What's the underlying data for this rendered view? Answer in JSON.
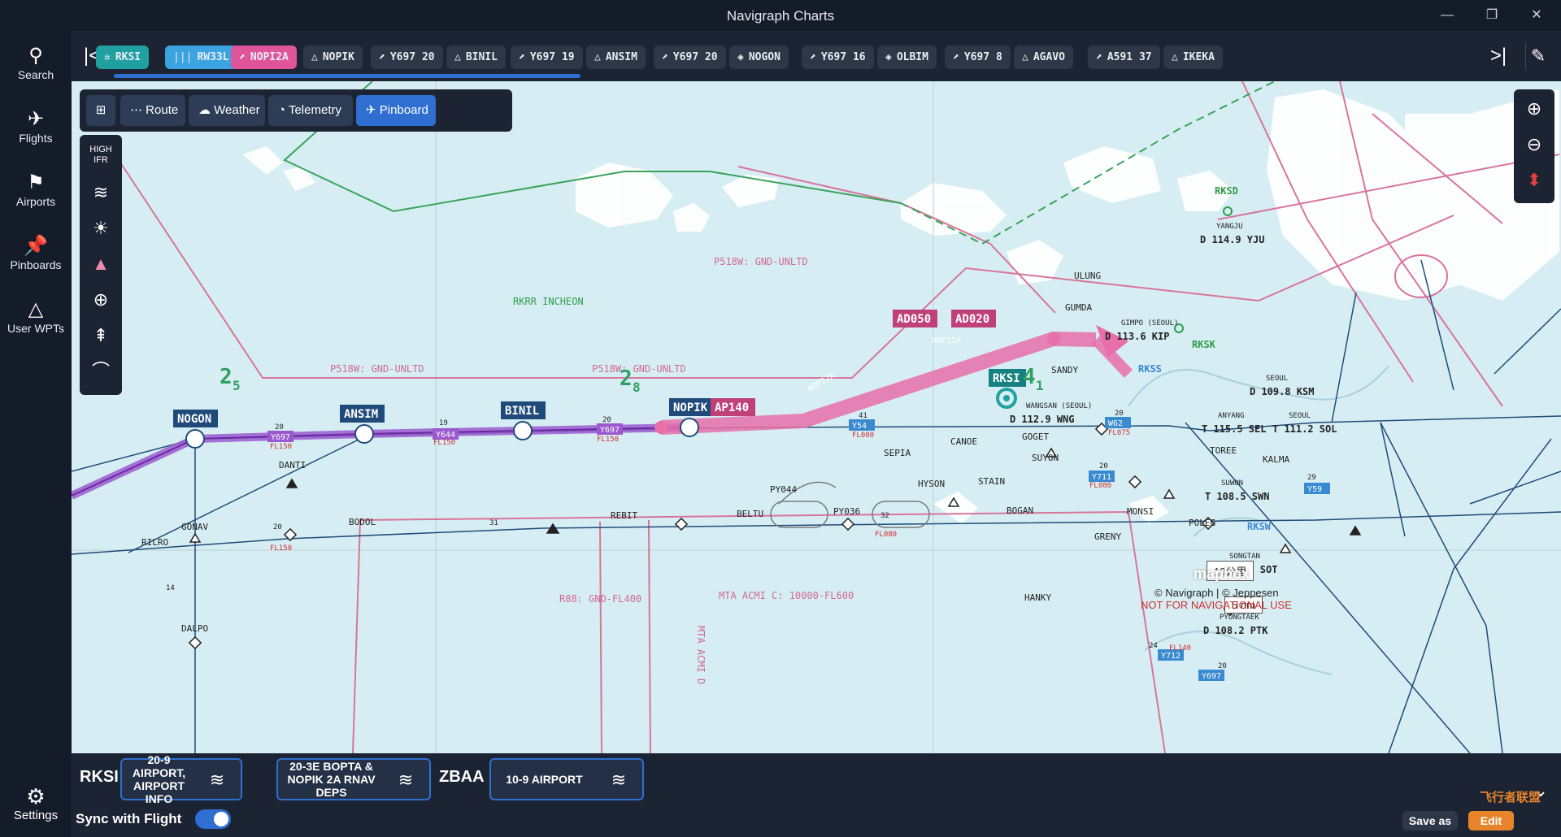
{
  "window": {
    "title": "Navigraph Charts",
    "minimize": "—",
    "maximize": "❐",
    "close": "✕"
  },
  "sidebar": {
    "items": [
      {
        "label": "Search",
        "icon": "search-icon",
        "glyph": "⚲"
      },
      {
        "label": "Flights",
        "icon": "airplane-icon",
        "glyph": "✈"
      },
      {
        "label": "Airports",
        "icon": "windsock-icon",
        "glyph": "⚑"
      },
      {
        "label": "Pinboards",
        "icon": "pin-icon",
        "glyph": "📌"
      },
      {
        "label": "User WPTs",
        "icon": "triangle-icon",
        "glyph": "△"
      }
    ],
    "settings": {
      "label": "Settings",
      "glyph": "⚙"
    }
  },
  "route_chips": [
    {
      "label": "RKSI",
      "icon": "airport-icon",
      "glyph": "✲",
      "color": "#20a0a0"
    },
    {
      "label": "RW33L",
      "icon": "runway-icon",
      "glyph": "|||",
      "color": "#3aa3e0"
    },
    {
      "label": "NOPI2A",
      "icon": "sid-icon",
      "glyph": "⬈",
      "color": "#e0559a"
    },
    {
      "label": "NOPIK",
      "icon": "waypoint-icon",
      "glyph": "△"
    },
    {
      "label": "Y697 20",
      "icon": "airway-icon",
      "glyph": "⬈"
    },
    {
      "label": "BINIL",
      "icon": "waypoint-icon",
      "glyph": "△"
    },
    {
      "label": "Y697 19",
      "icon": "airway-icon",
      "glyph": "⬈"
    },
    {
      "label": "ANSIM",
      "icon": "waypoint-icon",
      "glyph": "△"
    },
    {
      "label": "Y697 20",
      "icon": "airway-icon",
      "glyph": "⬈"
    },
    {
      "label": "NOGON",
      "icon": "vor-icon",
      "glyph": "◈"
    },
    {
      "label": "Y697 16",
      "icon": "airway-icon",
      "glyph": "⬈"
    },
    {
      "label": "OLBIM",
      "icon": "vor-icon",
      "glyph": "◈"
    },
    {
      "label": "Y697 8",
      "icon": "airway-icon",
      "glyph": "⬈"
    },
    {
      "label": "AGAVO",
      "icon": "waypoint-icon",
      "glyph": "△"
    },
    {
      "label": "A591 37",
      "icon": "airway-icon",
      "glyph": "⬈"
    },
    {
      "label": "IKEKA",
      "icon": "waypoint-icon",
      "glyph": "△"
    }
  ],
  "route_scroll_progress": 0.33,
  "toolbar": {
    "route": "Route",
    "weather": "Weather",
    "telemetry": "Telemetry",
    "pinboard": "Pinboard"
  },
  "map_tools": {
    "high_ifr": "HIGH IFR"
  },
  "bottom": {
    "airport1": "RKSI",
    "doc1": "20-9 AIRPORT, AIRPORT INFO",
    "doc2": "20-3E BOPTA & NOPIK 2A RNAV DEPS",
    "airport2": "ZBAA",
    "doc3": "10-9 AIRPORT",
    "sync": "Sync with Flight",
    "save": "Save as",
    "edit": "Edit"
  },
  "map": {
    "waypoints": [
      "NOGON",
      "ANSIM",
      "BINIL",
      "NOPIK"
    ],
    "tags": {
      "ap140": "AP140",
      "ad050": "AD050",
      "ad020": "AD020",
      "rksi": "RKSI",
      "nopi2a": "NOPI2A"
    },
    "airspace": [
      "P518W: GND-UNLTD",
      "P518W: GND-UNLTD",
      "P518W: GND-UNLTD",
      "RKRR INCHEON",
      "R88: GND-FL400",
      "MTA ACMI C: 10000-FL600",
      "MTA ACMI D"
    ],
    "fixes": [
      "DANTI",
      "GONAV",
      "BODOL",
      "REBIT",
      "BELTU",
      "PY044",
      "PY036",
      "SEPIA",
      "CANOE",
      "HYSON",
      "STAIN",
      "BOGAN",
      "GRENY",
      "HANKY",
      "DALPO",
      "RILRO",
      "GOGET",
      "SUYON",
      "SANDY",
      "ULUNG",
      "GUMDA",
      "MONSI",
      "POLEG",
      "TOREE",
      "KALMA"
    ],
    "navaids": [
      {
        "name": "YANGJU",
        "freq": "D 114.9 YJU"
      },
      {
        "name": "GIMPO (SEOUL)",
        "freq": "D 113.6 KIP"
      },
      {
        "name": "WANGSAN (SEOUL)",
        "freq": "D 112.9 WNG"
      },
      {
        "name": "SEOUL",
        "freq": "D 109.8 KSM"
      },
      {
        "name": "ANYANG",
        "freq": "T 115.5 SEL"
      },
      {
        "name": "SEOUL",
        "freq": "T 111.2 SOL"
      },
      {
        "name": "SUWON",
        "freq": "T 108.5 SWN"
      },
      {
        "name": "SONGTAN",
        "freq": "T 116.9 SOT"
      },
      {
        "name": "PYONGTAEK",
        "freq": "D 108.2 PTK"
      }
    ],
    "airports_other": [
      "RKSD",
      "RKSK",
      "RKSS",
      "RKSW"
    ],
    "airways": [
      "Y697",
      "Y644",
      "Y697",
      "Y54",
      "W62",
      "Y711",
      "Y59",
      "Y712",
      "Y697"
    ],
    "flight_levels": [
      "FL150",
      "FL150",
      "FL150",
      "FL080",
      "FL075",
      "FL080",
      "FL080",
      "FL150",
      "FL140"
    ],
    "mea": [
      "20",
      "19",
      "20",
      "41",
      "20",
      "20",
      "31",
      "32",
      "20",
      "14",
      "29",
      "24",
      "20"
    ],
    "sectors": [
      {
        "main": "2",
        "sub": "5"
      },
      {
        "main": "2",
        "sub": "8"
      },
      {
        "main": "4",
        "sub": "1"
      }
    ],
    "scale": {
      "km": "10公里",
      "nm": "5 nm"
    },
    "credits": "© Navigraph | © Jeppesen",
    "warning": "NOT FOR NAVIGATIONAL USE",
    "mapbox": "mapbox",
    "watermark": "飞行者联盟"
  }
}
